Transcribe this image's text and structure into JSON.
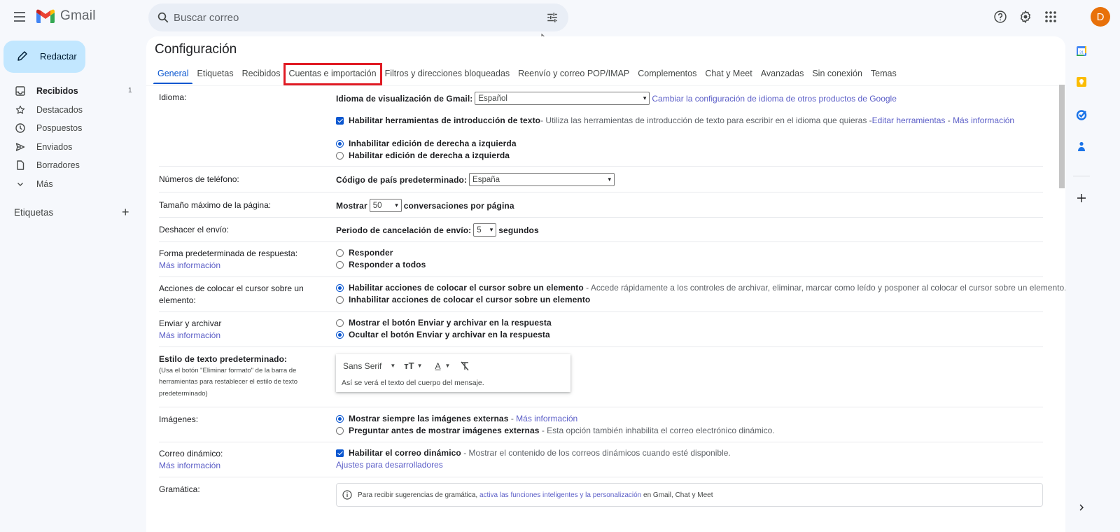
{
  "header": {
    "app_name": "Gmail",
    "search_placeholder": "Buscar correo",
    "avatar_initial": "D",
    "icons": [
      "menu-icon",
      "gmail-logo",
      "search-icon",
      "tune-icon",
      "help-icon",
      "gear-icon",
      "apps-icon"
    ]
  },
  "sidebar": {
    "compose_label": "Redactar",
    "items": [
      {
        "label": "Recibidos",
        "icon": "inbox-icon",
        "count": "1",
        "bold": true
      },
      {
        "label": "Destacados",
        "icon": "star-icon"
      },
      {
        "label": "Pospuestos",
        "icon": "clock-icon"
      },
      {
        "label": "Enviados",
        "icon": "send-icon"
      },
      {
        "label": "Borradores",
        "icon": "draft-icon"
      },
      {
        "label": "Más",
        "icon": "chevron-down-icon"
      }
    ],
    "labels_header": "Etiquetas",
    "labels_add": "+"
  },
  "settings": {
    "title": "Configuración",
    "tabs": [
      {
        "label": "General",
        "active": true
      },
      {
        "label": "Etiquetas"
      },
      {
        "label": "Recibidos"
      },
      {
        "label": "Cuentas e importación",
        "highlighted": true
      },
      {
        "label": "Filtros y direcciones bloqueadas"
      },
      {
        "label": "Reenvío y correo POP/IMAP"
      },
      {
        "label": "Complementos"
      },
      {
        "label": "Chat y Meet"
      },
      {
        "label": "Avanzadas"
      },
      {
        "label": "Sin conexión"
      },
      {
        "label": "Temas"
      }
    ],
    "language": {
      "label": "Idioma:",
      "display_label": "Idioma de visualización de Gmail:",
      "display_value": "Español",
      "change_link": "Cambiar la configuración de idioma de otros productos de Google",
      "input_tools_checked": true,
      "input_tools_label": "Habilitar herramientas de introducción de texto",
      "input_tools_desc": " - Utiliza las herramientas de introducción de texto para escribir en el idioma que quieras - ",
      "edit_tools_link": "Editar herramientas",
      "sep": " - ",
      "more_info_link": "Más información",
      "rtl_off_label": "Inhabilitar edición de derecha a izquierda",
      "rtl_on_label": "Habilitar edición de derecha a izquierda",
      "rtl_selected": "off"
    },
    "phone": {
      "label": "Números de teléfono:",
      "country_label": "Código de país predeterminado:",
      "country_value": "España"
    },
    "page_size": {
      "label": "Tamaño máximo de la página:",
      "prefix": "Mostrar",
      "value": "50",
      "suffix": "conversaciones por página"
    },
    "undo_send": {
      "label": "Deshacer el envío:",
      "prefix": "Periodo de cancelación de envío:",
      "value": "5",
      "suffix": "segundos"
    },
    "reply": {
      "label": "Forma predeterminada de respuesta:",
      "more_info": "Más información",
      "options": [
        "Responder",
        "Responder a todos"
      ],
      "selected": null
    },
    "hover": {
      "label": "Acciones de colocar el cursor sobre un elemento:",
      "enable_label": "Habilitar acciones de colocar el cursor sobre un elemento",
      "enable_desc": " - Accede rápidamente a los controles de archivar, eliminar, marcar como leído y posponer al colocar el cursor sobre un elemento.",
      "disable_label": "Inhabilitar acciones de colocar el cursor sobre un elemento",
      "selected": "enable"
    },
    "send_archive": {
      "label": "Enviar y archivar",
      "more_info": "Más información",
      "show_label": "Mostrar el botón Enviar y archivar en la respuesta",
      "hide_label": "Ocultar el botón Enviar y archivar en la respuesta",
      "selected": "hide"
    },
    "text_style": {
      "label": "Estilo de texto predeterminado:",
      "hint": "(Usa el botón \"Eliminar formato\" de la barra de herramientas para restablecer el estilo de texto predeterminado)",
      "font": "Sans Serif",
      "sample": "Así se verá el texto del cuerpo del mensaje."
    },
    "images": {
      "label": "Imágenes:",
      "always_label": "Mostrar siempre las imágenes externas",
      "always_sep": " - ",
      "always_link": "Más información",
      "ask_label": "Preguntar antes de mostrar imágenes externas",
      "ask_desc": " - Esta opción también inhabilita el correo electrónico dinámico.",
      "selected": "always"
    },
    "dynamic": {
      "label": "Correo dinámico:",
      "more_info": "Más información",
      "checked": true,
      "enable_label": "Habilitar el correo dinámico",
      "enable_desc": " - Mostrar el contenido de los correos dinámicos cuando esté disponible.",
      "dev_link": "Ajustes para desarrolladores"
    },
    "grammar": {
      "label": "Gramática:",
      "text_before": "Para recibir sugerencias de gramática, ",
      "link": "activa las funciones inteligentes y la personalización",
      "text_after": " en Gmail, Chat y Meet"
    }
  },
  "right_rail": {
    "icons": [
      "calendar-icon",
      "keep-icon",
      "tasks-icon",
      "contacts-icon",
      "add-icon",
      "chevron-right-icon"
    ]
  },
  "colors": {
    "accent": "#0b57d0",
    "compose_bg": "#c2e7ff",
    "link": "#5b5ec7",
    "highlight_box": "#e01b24",
    "avatar": "#e8710a"
  }
}
